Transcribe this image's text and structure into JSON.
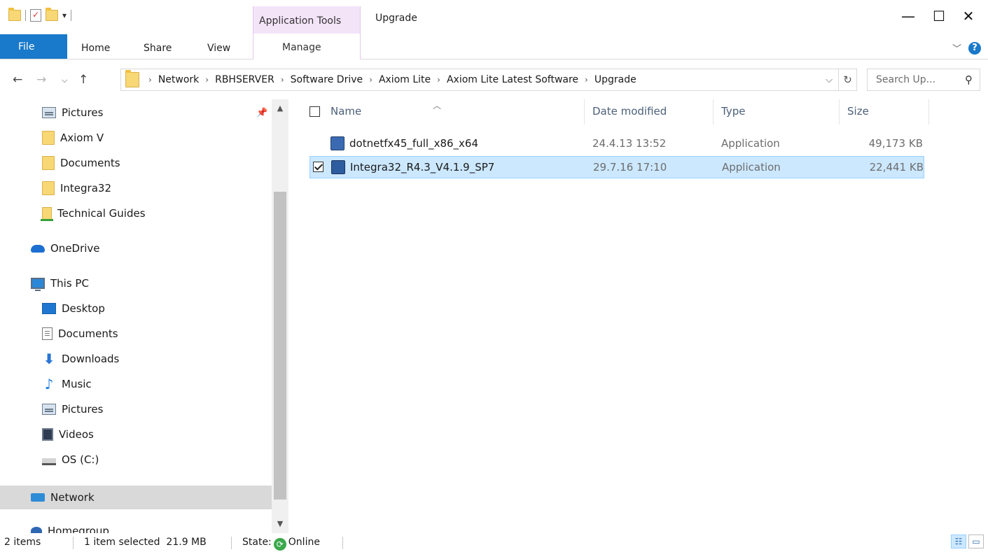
{
  "window": {
    "title": "Upgrade",
    "context_tab_group": "Application Tools",
    "minimize_glyph": "—",
    "maximize_glyph": "☐",
    "close_glyph": "✕"
  },
  "ribbon": {
    "tabs": [
      "File",
      "Home",
      "Share",
      "View"
    ],
    "manage_tab": "Manage"
  },
  "address": {
    "crumbs": [
      "Network",
      "RBHSERVER",
      "Software Drive",
      "Axiom Lite",
      "Axiom Lite Latest Software",
      "Upgrade"
    ],
    "search_placeholder": "Search Up..."
  },
  "nav_pane": {
    "items": [
      {
        "label": "Pictures",
        "icon": "pictures-icon"
      },
      {
        "label": "Axiom V",
        "icon": "folder-icon"
      },
      {
        "label": "Documents",
        "icon": "folder-icon"
      },
      {
        "label": "Integra32",
        "icon": "folder-icon"
      },
      {
        "label": "Technical Guides",
        "icon": "shared-folder-icon"
      },
      {
        "label": "OneDrive",
        "icon": "onedrive-icon"
      },
      {
        "label": "This PC",
        "icon": "computer-icon"
      },
      {
        "label": "Desktop",
        "icon": "desktop-icon"
      },
      {
        "label": "Documents",
        "icon": "documents-icon"
      },
      {
        "label": "Downloads",
        "icon": "downloads-icon"
      },
      {
        "label": "Music",
        "icon": "music-icon"
      },
      {
        "label": "Pictures",
        "icon": "pictures-icon"
      },
      {
        "label": "Videos",
        "icon": "videos-icon"
      },
      {
        "label": "OS (C:)",
        "icon": "drive-icon"
      },
      {
        "label": "Network",
        "icon": "network-icon"
      },
      {
        "label": "Homegroup",
        "icon": "homegroup-icon"
      }
    ]
  },
  "file_list": {
    "columns": [
      "Name",
      "Date modified",
      "Type",
      "Size"
    ],
    "rows": [
      {
        "name": "dotnetfx45_full_x86_x64",
        "date": "24.4.13 13:52",
        "type": "Application",
        "size": "49,173 KB",
        "selected": false
      },
      {
        "name": "Integra32_R4.3_V4.1.9_SP7",
        "date": "29.7.16 17:10",
        "type": "Application",
        "size": "22,441 KB",
        "selected": true
      }
    ]
  },
  "status": {
    "items_count": "2 items",
    "selection": "1 item selected  21.9 MB",
    "state_label": "State:",
    "state_value": "Online"
  },
  "colors": {
    "accent": "#1979ca",
    "context_tab": "#f4e4f8",
    "selection": "#cce8ff"
  }
}
